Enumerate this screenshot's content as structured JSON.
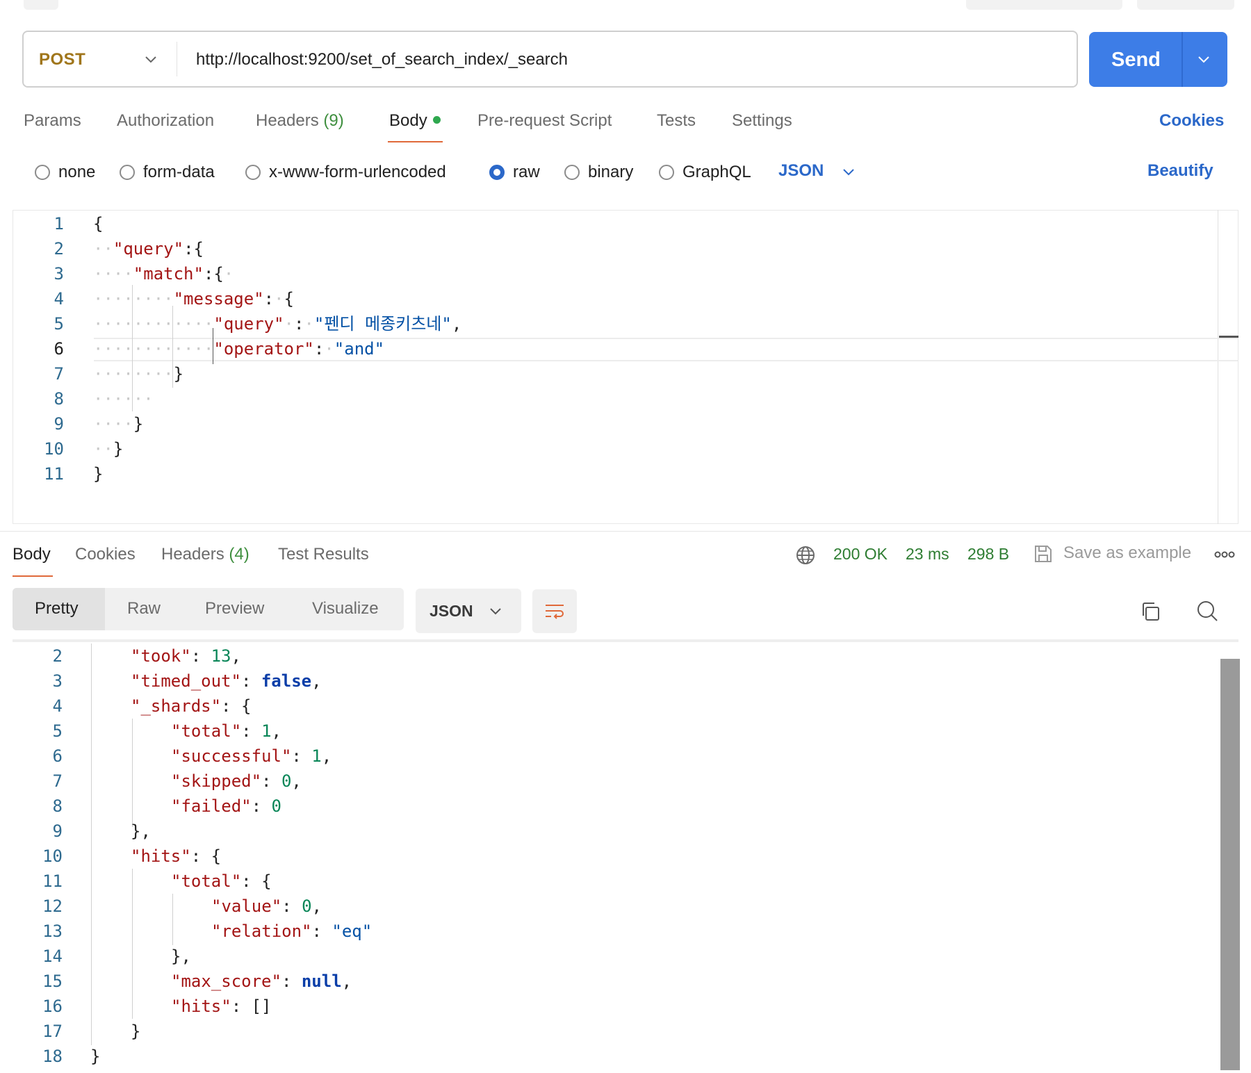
{
  "request": {
    "method": "POST",
    "url": "http://localhost:9200/set_of_search_index/_search",
    "send_label": "Send"
  },
  "request_tabs": {
    "params": "Params",
    "authorization": "Authorization",
    "headers": "Headers",
    "headers_count": "(9)",
    "body": "Body",
    "prerequest": "Pre-request Script",
    "tests": "Tests",
    "settings": "Settings",
    "cookies": "Cookies"
  },
  "body_types": {
    "none": "none",
    "form_data": "form-data",
    "urlencoded": "x-www-form-urlencoded",
    "raw": "raw",
    "binary": "binary",
    "graphql": "GraphQL",
    "selected": "raw",
    "format": "JSON",
    "beautify": "Beautify"
  },
  "request_body": {
    "line_numbers": [
      "1",
      "2",
      "3",
      "4",
      "5",
      "6",
      "7",
      "8",
      "9",
      "10",
      "11"
    ],
    "tokens": {
      "open": "{",
      "close": "}",
      "colon": ":",
      "comma": ",",
      "query": "\"query\"",
      "match": "\"match\"",
      "message": "\"message\"",
      "query_value": "\"펜디 메종키츠네\"",
      "operator": "\"operator\"",
      "and": "\"and\""
    }
  },
  "response_tabs": {
    "body": "Body",
    "cookies": "Cookies",
    "headers": "Headers",
    "headers_count": "(4)",
    "test_results": "Test Results"
  },
  "response_status": {
    "code": "200 OK",
    "time": "23 ms",
    "size": "298 B",
    "save_example": "Save as example"
  },
  "response_view": {
    "pretty": "Pretty",
    "raw": "Raw",
    "preview": "Preview",
    "visualize": "Visualize",
    "format": "JSON"
  },
  "response_body": {
    "line_numbers": [
      "2",
      "3",
      "4",
      "5",
      "6",
      "7",
      "8",
      "9",
      "10",
      "11",
      "12",
      "13",
      "14",
      "15",
      "16",
      "17",
      "18"
    ],
    "tokens": {
      "took": "\"took\"",
      "took_value": "13",
      "timed_out": "\"timed_out\"",
      "timed_out_value": "false",
      "shards": "\"_shards\"",
      "total": "\"total\"",
      "total_value": "1",
      "successful": "\"successful\"",
      "successful_value": "1",
      "skipped": "\"skipped\"",
      "skipped_value": "0",
      "failed": "\"failed\"",
      "failed_value": "0",
      "hits": "\"hits\"",
      "value": "\"value\"",
      "value_value": "0",
      "relation": "\"relation\"",
      "relation_value": "\"eq\"",
      "max_score": "\"max_score\"",
      "max_score_value": "null",
      "empty_array": "[]",
      "open": "{",
      "close": "}",
      "close_comma": "},",
      "colon": ": ",
      "comma": ","
    }
  },
  "icons": {
    "method_chevron": "chevron-down-icon",
    "send_chevron": "chevron-down-icon",
    "format_chevron": "chevron-down-icon",
    "globe": "globe-icon",
    "save": "save-icon",
    "more": "more-horizontal-icon",
    "wrap": "wrap-lines-icon",
    "copy": "copy-icon",
    "search": "search-icon"
  },
  "colors": {
    "accent": "#3d7de7",
    "method": "#a0761b",
    "active_tab_underline": "#e0693a",
    "status_ok": "#2e7d32",
    "body_dot": "#2fa84f"
  }
}
